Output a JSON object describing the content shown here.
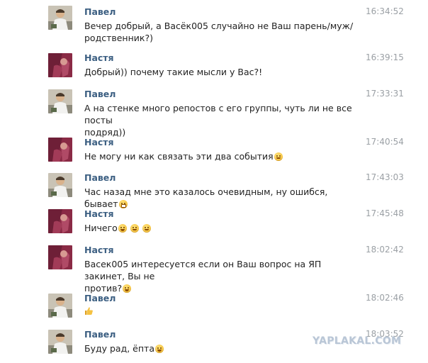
{
  "messages": [
    {
      "sender": "Павел",
      "time": "16:34:52",
      "lines": [
        "Вечер добрый, а Васёк005 случайно не Ваш парень/муж/",
        "родственник?)"
      ],
      "avatar": "pavel-avatar"
    },
    {
      "sender": "Настя",
      "time": "16:39:15",
      "lines": [
        "Добрый)) почему такие мысли у Вас?!"
      ],
      "avatar": "nastya-avatar"
    },
    {
      "sender": "Павел",
      "time": "17:33:31",
      "lines": [
        "А на стенке много репостов с его группы, чуть ли не все посты",
        "подряд))"
      ],
      "avatar": "pavel-avatar"
    },
    {
      "sender": "Настя",
      "time": "17:40:54",
      "lines": [
        "Не могу ни как связать эти два события"
      ],
      "emoji": [
        "unamused-emoji"
      ],
      "avatar": "nastya-avatar"
    },
    {
      "sender": "Павел",
      "time": "17:43:03",
      "lines": [
        "Час назад мне это казалось очевидным, ну ошибся, бывает"
      ],
      "emoji": [
        "grimace-emoji"
      ],
      "avatar": "pavel-avatar"
    },
    {
      "sender": "Настя",
      "time": "17:45:48",
      "lines": [
        "Ничего"
      ],
      "emoji": [
        "laugh-emoji",
        "unamused-emoji",
        "unamused-emoji"
      ],
      "avatar": "nastya-avatar"
    },
    {
      "sender": "Настя",
      "time": "18:02:42",
      "lines": [
        "Васек005 интересуется если он Ваш вопрос на ЯП закинет, Вы не",
        "против?"
      ],
      "emoji": [
        "tears-of-joy-emoji"
      ],
      "avatar": "nastya-avatar"
    },
    {
      "sender": "Павел",
      "time": "18:02:46",
      "lines": [
        ""
      ],
      "emoji": [
        "thumbs-up-emoji"
      ],
      "avatar": "pavel-avatar"
    },
    {
      "sender": "Павел",
      "time": "18:03:52",
      "lines": [
        "Буду рад, ёпта"
      ],
      "emoji": [
        "tears-of-joy-emoji"
      ],
      "avatar": "pavel-avatar"
    }
  ],
  "watermark": "YAPLAKAL.COM",
  "colors": {
    "sender_name": "#3c5f82",
    "timestamp": "#9ba0a5",
    "message_text": "#222222",
    "watermark": "#b9c6d6"
  }
}
